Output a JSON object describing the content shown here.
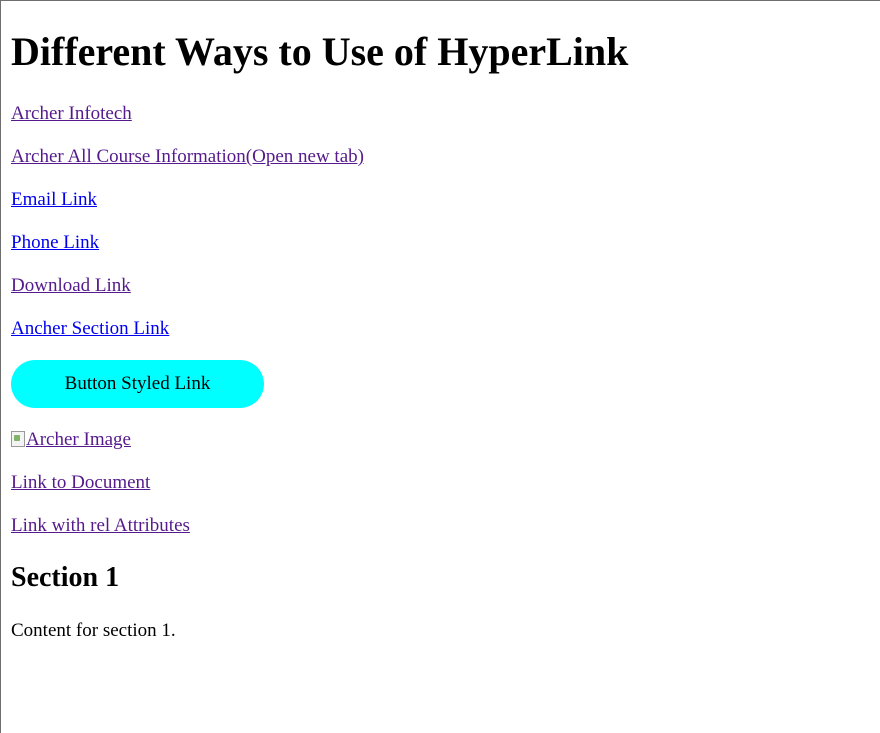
{
  "page": {
    "heading": "Different Ways to Use of HyperLink"
  },
  "links": {
    "archer_infotech": "Archer Infotech",
    "course_info": "Archer All Course Information(Open new tab)",
    "email": "Email Link",
    "phone": "Phone Link",
    "download": "Download Link",
    "anchor_section": "Ancher Section Link",
    "button_styled": "Button Styled Link",
    "image_alt": "Archer Image",
    "document": "Link to Document",
    "rel_attributes": "Link with rel Attributes"
  },
  "section1": {
    "heading": "Section 1",
    "content": "Content for section 1."
  },
  "colors": {
    "visited_link": "#551a8b",
    "unvisited_link": "#0000ee",
    "button_background": "#00ffff"
  }
}
